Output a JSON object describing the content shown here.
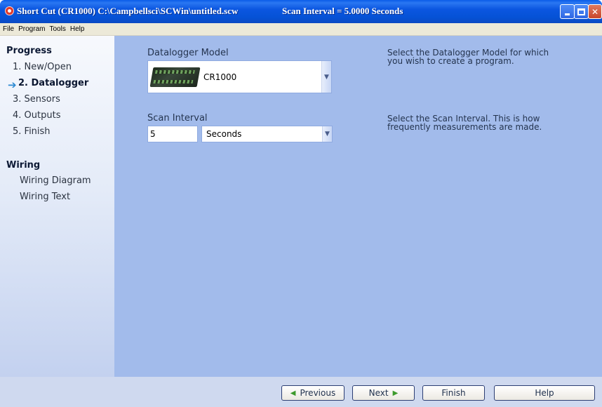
{
  "window": {
    "title": "Short Cut (CR1000) C:\\Campbellsci\\SCWin\\untitled.scw",
    "scan_status": "Scan Interval = 5.0000 Seconds",
    "minimize_icon": "minimize-icon",
    "maximize_icon": "maximize-icon",
    "close_icon": "close-icon",
    "close_glyph": "✕"
  },
  "menu": {
    "items": [
      {
        "label": "File"
      },
      {
        "label": "Program"
      },
      {
        "label": "Tools"
      },
      {
        "label": "Help"
      }
    ]
  },
  "sidebar": {
    "progress_heading": "Progress",
    "current_marker": "➔",
    "steps": [
      {
        "label": "1. New/Open",
        "current": false
      },
      {
        "label": "2. Datalogger",
        "current": true
      },
      {
        "label": "3. Sensors",
        "current": false
      },
      {
        "label": "4. Outputs",
        "current": false
      },
      {
        "label": "5. Finish",
        "current": false
      }
    ],
    "wiring_heading": "Wiring",
    "wiring_links": [
      {
        "label": "Wiring Diagram"
      },
      {
        "label": "Wiring Text"
      }
    ]
  },
  "main": {
    "model_label": "Datalogger Model",
    "model_value": "CR1000",
    "model_help": "Select the Datalogger Model for which you wish to create a program.",
    "scan_label": "Scan Interval",
    "scan_value": "5",
    "scan_unit": "Seconds",
    "scan_help": "Select the Scan Interval. This is how frequently measurements are made."
  },
  "footer": {
    "previous_label": "Previous",
    "next_label": "Next",
    "finish_label": "Finish",
    "help_label": "Help",
    "previous_arrow": "◀",
    "next_arrow": "▶"
  },
  "colors": {
    "titlebar": "#0552d6",
    "main_panel": "#a2bbeb",
    "sidebar_top": "#f7f9fd",
    "current_arrow": "#2d8ad2"
  }
}
